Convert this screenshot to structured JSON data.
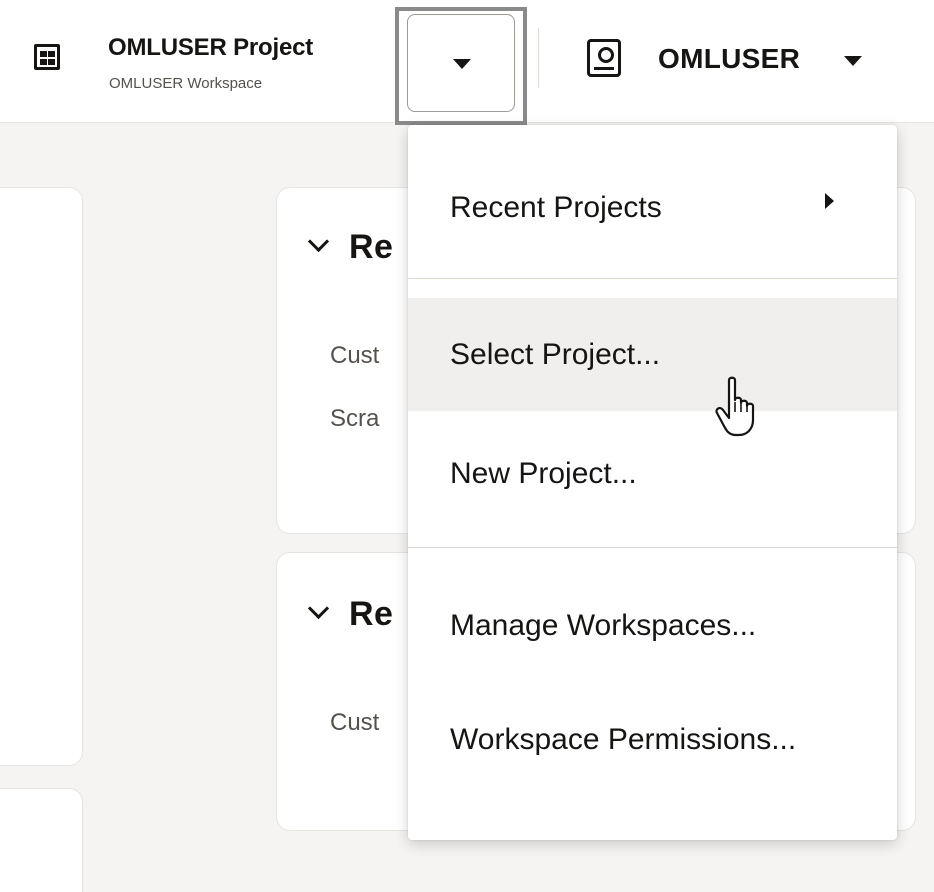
{
  "header": {
    "project_title": "OMLUSER Project",
    "workspace_subtitle": "OMLUSER Workspace",
    "user_name": "OMLUSER"
  },
  "cards": [
    {
      "title": "Re",
      "items": [
        "Cust",
        "Scra"
      ]
    },
    {
      "title": "Re",
      "items": [
        "Cust"
      ]
    }
  ],
  "menu": {
    "items": [
      {
        "label": "Recent Projects",
        "has_submenu": true
      },
      {
        "label": "Select Project...",
        "hovered": true
      },
      {
        "label": "New Project..."
      },
      {
        "label": "Manage Workspaces..."
      },
      {
        "label": "Workspace Permissions..."
      }
    ]
  },
  "icons": {
    "project": "grid-icon",
    "dropdown": "caret-down-icon",
    "user": "user-badge-icon",
    "submenu": "caret-right-icon",
    "cursor": "hand-pointer-cursor"
  },
  "colors": {
    "text": "#161513",
    "muted": "#55524e",
    "hover": "#f1efed",
    "background": "#f5f4f2"
  }
}
